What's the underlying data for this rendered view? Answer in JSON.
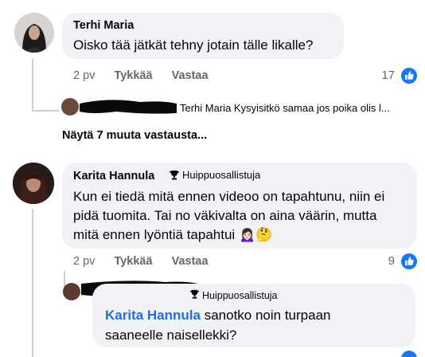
{
  "comments": [
    {
      "author": "Terhi Maria",
      "text": "Oisko tää jätkät tehny jotain tälle likalle?",
      "time": "2 pv",
      "like_label": "Tykkää",
      "reply_label": "Vastaa",
      "reaction_count": "17",
      "reply_preview": "Terhi Maria Kysyisitkö samaa jos poika olis l...",
      "more_replies": "Näytä 7 muuta vastausta..."
    },
    {
      "author": "Karita Hannula",
      "badge": "Huippuosallistuja",
      "text_lines": [
        "Kun ei tiedä mitä ennen videoo on tapahtunu, niin ei",
        "pidä tuomita. Tai no väkivalta on aina väärin, mutta",
        "mitä ennen lyöntiä tapahtui"
      ],
      "emojis": "🙍🏻‍♀️🤔",
      "time": "2 pv",
      "like_label": "Tykkää",
      "reply_label": "Vastaa",
      "reaction_count": "9"
    }
  ],
  "reply": {
    "badge": "Huippuosallistuja",
    "mention": "Karita Hannula",
    "text_line1": " sanotko noin turpaan",
    "text_line2": "saaneelle naisellekki?"
  },
  "colors": {
    "like_blue": "#1877f2",
    "mention_blue": "#216fdb",
    "bubble_bg": "#f0f2f5",
    "meta_gray": "#65676b"
  },
  "icons": [
    "like-thumb-icon",
    "trophy-icon",
    "reply-curve-icon"
  ]
}
